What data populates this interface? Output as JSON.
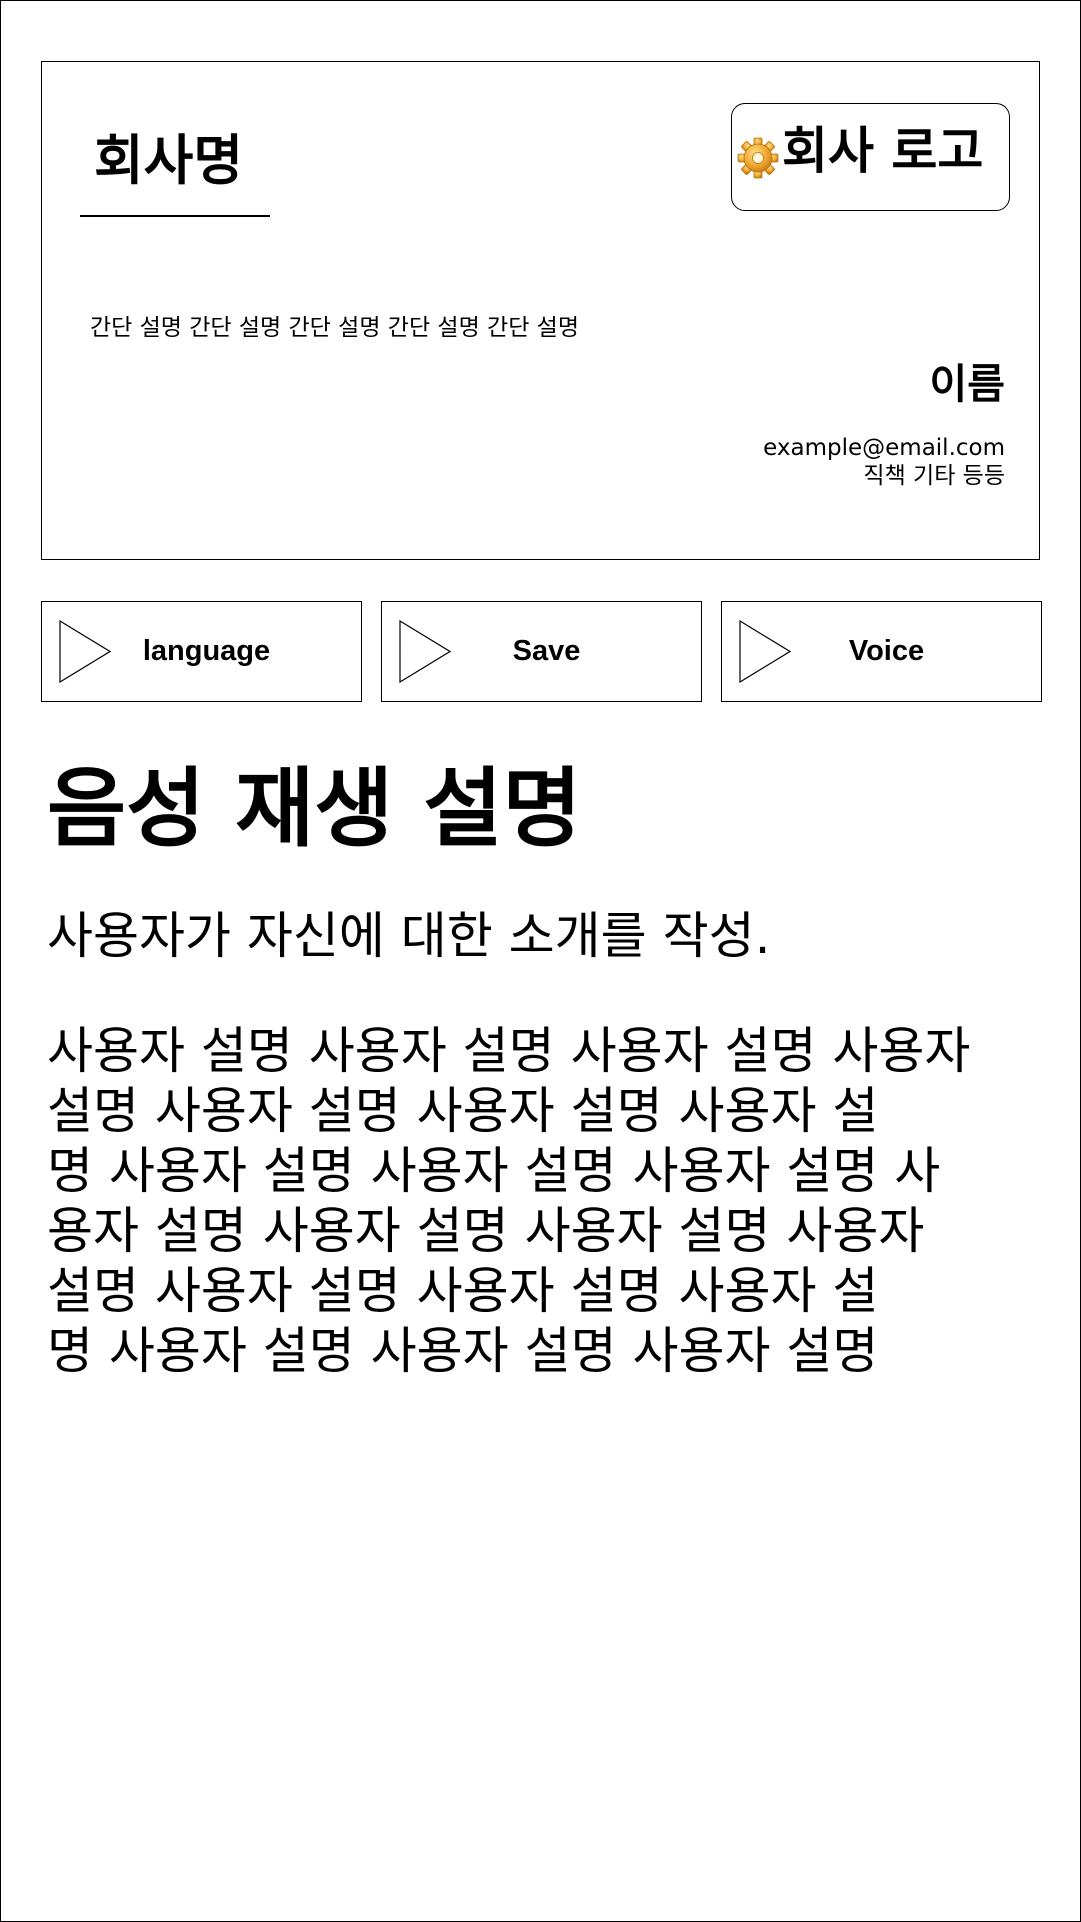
{
  "card": {
    "company_name": "회사명",
    "logo_text": "회사 로고",
    "summary": "간단 설명 간단 설명 간단 설명 간단 설명 간단 설명",
    "person_name": "이름",
    "email": "example@email.com",
    "role": "직책 기타 등등"
  },
  "buttons": {
    "language": "language",
    "save": "Save",
    "voice": "Voice"
  },
  "section": {
    "title": "음성 재생 설명",
    "intro": "사용자가 자신에 대한 소개를 작성.",
    "lines": [
      "사용자 설명 사용자 설명 사용자 설명 사용자",
      "설명 사용자 설명 사용자 설명 사용자 설",
      "명 사용자 설명 사용자 설명 사용자 설명 사",
      "용자 설명 사용자 설명 사용자 설명 사용자",
      "설명 사용자 설명 사용자 설명 사용자 설",
      "명 사용자 설명 사용자 설명 사용자 설명"
    ]
  },
  "icons": {
    "logo": "gear-icon",
    "button_play": "play-triangle-icon"
  },
  "colors": {
    "logo_gear": "#f0a830"
  }
}
